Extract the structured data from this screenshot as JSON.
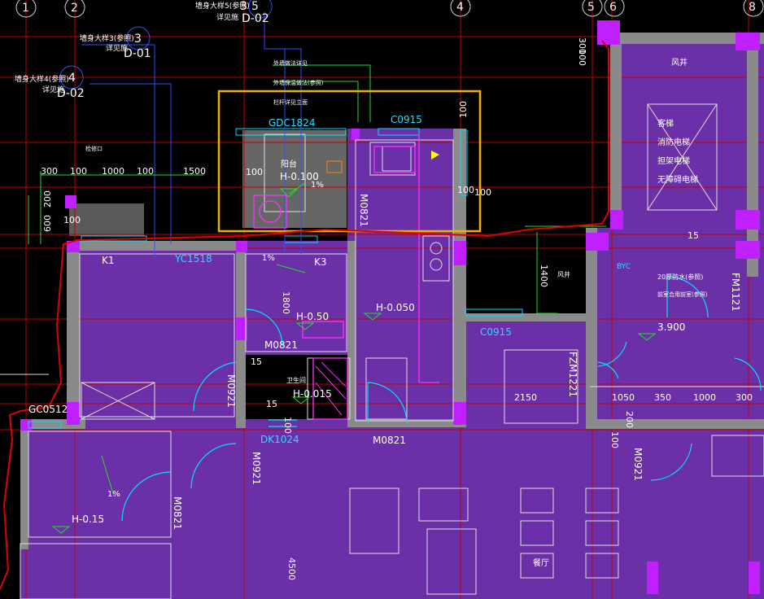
{
  "grid_labels": [
    "1",
    "2",
    "3",
    "5",
    "4",
    "5",
    "6",
    "8"
  ],
  "callouts": [
    {
      "num": "3",
      "ref": "D-01",
      "note1": "墙身大样3(参照)",
      "note2": "详见施"
    },
    {
      "num": "4",
      "ref": "D-02",
      "note1": "墙身大样4(参照)",
      "note2": "详见施"
    },
    {
      "num": "5",
      "ref": "D-02",
      "note1": "墙身大样5(参照)",
      "note2": "详见施"
    }
  ],
  "notes": [
    "外墙做法详见",
    "外墙保温做法(参照)",
    "栏杆详见立面"
  ],
  "window_labels": {
    "gdc1824": "GDC1824",
    "c0915_top": "C0915",
    "yc1518": "YC1518",
    "k1": "K1",
    "k3": "K3",
    "c0915_mid": "C0915",
    "gc0512": "GC0512",
    "dk1024": "DK1024",
    "byc": "BYC"
  },
  "door_labels": {
    "m0821_a": "M0821",
    "m0821_b": "M0821",
    "m0821_c": "M0821",
    "m0821_d": "M0821",
    "m0921_a": "M0921",
    "m0921_b": "M0921",
    "m0921_c": "M0921",
    "fzm1221": "FZM1221",
    "fm1121": "FM1121"
  },
  "room_labels": {
    "balcony": "阳台",
    "wind": "风井",
    "shaft1": "客梯",
    "shaft2": "消防电梯",
    "shaft3": "担架电梯",
    "shaft4": "无障碍电梯",
    "living": "餐厅",
    "wind2": "风井",
    "bath": "卫生间",
    "note20": "20厚防水(参照)",
    "note_shaft": "前室合用前室(参照)"
  },
  "levels": [
    "H-0.100",
    "H-0.50",
    "H-0.050",
    "H-0.015",
    "H-0.15",
    "3.900"
  ],
  "slopes": [
    "1%",
    "1%",
    "1%"
  ],
  "dims_top": [
    "300",
    "100",
    "1000",
    "100",
    "1500"
  ],
  "dims_left": [
    "200",
    "600",
    "100"
  ],
  "dims_misc": [
    "100",
    "100",
    "100",
    "100",
    "1800",
    "15",
    "15",
    "100",
    "1400",
    "15",
    "100",
    "200",
    "100",
    "4500",
    "300",
    "100"
  ],
  "dims_bottom": [
    "2150",
    "1050",
    "350",
    "1000",
    "300"
  ],
  "annot_small": "检修口",
  "colors": {
    "wall": "#7a3fa0",
    "fill": "#6b2fa8",
    "red": "#d00",
    "yellow": "#f0b000",
    "cyan": "#00e0ff",
    "green": "#20e020",
    "blue": "#3050ff",
    "magenta": "#ff30ff",
    "gray": "#808080"
  }
}
